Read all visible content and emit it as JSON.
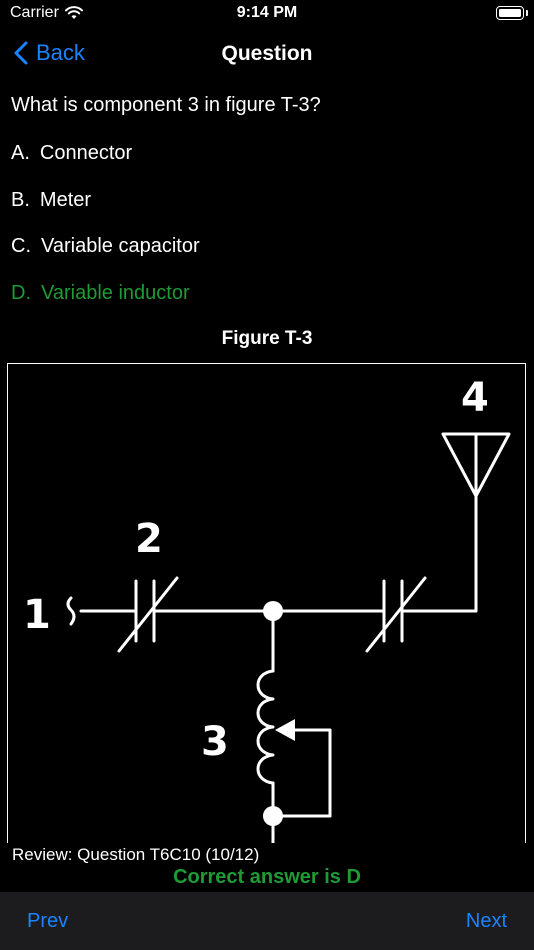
{
  "status_bar": {
    "carrier": "Carrier",
    "time": "9:14 PM",
    "wifi_icon": "wifi-icon",
    "battery_icon": "battery-icon"
  },
  "nav": {
    "back_label": "Back",
    "title": "Question",
    "back_icon": "chevron-left-icon"
  },
  "question": "What is component 3 in figure T-3?",
  "answers": [
    {
      "letter": "A.",
      "text": "Connector"
    },
    {
      "letter": "B.",
      "text": "Meter"
    },
    {
      "letter": "C.",
      "text": "Variable capacitor"
    },
    {
      "letter": "D.",
      "text": "Variable inductor",
      "correct": true
    }
  ],
  "figure": {
    "title": "Figure T-3",
    "labels": {
      "one": "1",
      "two": "2",
      "three": "3",
      "four": "4"
    }
  },
  "review": "Review:  Question T6C10 (10/12)",
  "correct_message": "Correct answer is D",
  "toolbar": {
    "prev_label": "Prev",
    "next_label": "Next"
  },
  "colors": {
    "accent": "#1a84ff",
    "correct": "#1e9b34",
    "background": "#000000",
    "toolbar": "#1c1c1e"
  }
}
